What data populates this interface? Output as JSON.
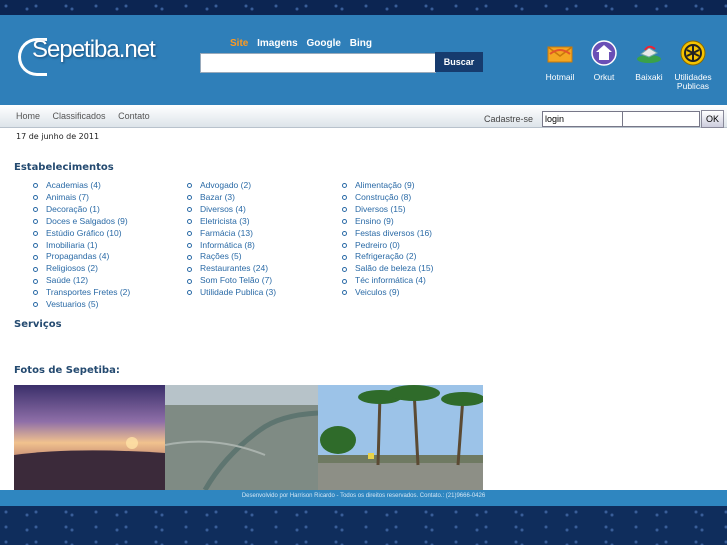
{
  "site": {
    "name": "Sepetiba.net"
  },
  "search": {
    "tabs": [
      "Site",
      "Imagens",
      "Google",
      "Bing"
    ],
    "button": "Buscar"
  },
  "header_icons": [
    {
      "label": "Hotmail",
      "icon": "hotmail-envelope-icon"
    },
    {
      "label": "Orkut",
      "icon": "orkut-house-icon"
    },
    {
      "label": "Baixaki",
      "icon": "baixaki-icon"
    },
    {
      "label": "Utilidades Publicas",
      "icon": "utilidades-icon"
    }
  ],
  "nav": {
    "items": [
      "Home",
      "Classificados",
      "Contato"
    ],
    "cadastre": "Cadastre-se"
  },
  "login": {
    "value": "login",
    "ok": "OK"
  },
  "date": "17 de junho de 2011",
  "estabelecimentos": {
    "title": "Estabelecimentos",
    "col1": [
      "Academias (4)",
      "Animais (7)",
      "Decoração (1)",
      "Doces e Salgados (9)",
      "Estúdio Gráfico (10)",
      "Imobiliaria (1)",
      "Propagandas (4)",
      "Religiosos (2)",
      "Saúde (12)",
      "Transportes Fretes (2)",
      "Vestuarios (5)"
    ],
    "col2": [
      "Advogado (2)",
      "Bazar (3)",
      "Diversos (4)",
      "Eletricista (3)",
      "Farmácia (13)",
      "Informática (8)",
      "Rações (5)",
      "Restaurantes (24)",
      "Som Foto Telão (7)",
      "Utilidade Publica (3)"
    ],
    "col3": [
      "Alimentação (9)",
      "Construção (8)",
      "Diversos (15)",
      "Ensino (9)",
      "Festas diversos (16)",
      "Pedreiro (0)",
      "Refrigeração (2)",
      "Salão de beleza (15)",
      "Téc informática (4)",
      "Veiculos (9)"
    ]
  },
  "servicos": {
    "title": "Serviços"
  },
  "fotos": {
    "title": "Fotos de Sepetiba:"
  },
  "footer": "Desenvolvido por Harrison Ricardo - Todos os direitos reservados. Contato.: (21)9666-0426",
  "colors": {
    "header": "#2f7fb9",
    "link": "#2a6aa6",
    "accent": "#ff9a1f",
    "button": "#163b6e"
  }
}
